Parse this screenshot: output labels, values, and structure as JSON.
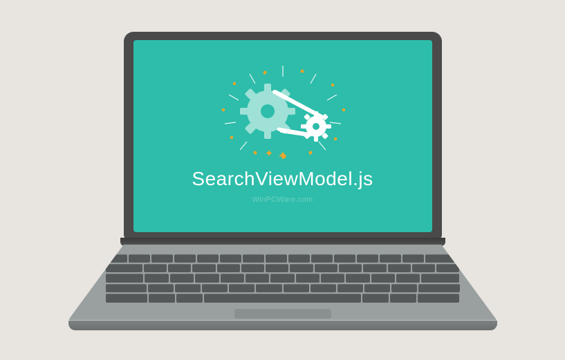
{
  "screen": {
    "filename": "SearchViewModel.js",
    "watermark": "WinPCWare.com"
  },
  "colors": {
    "screen_bg": "#2dbdaa",
    "accent": "#f5a623",
    "gear_light": "#9fe1d7",
    "gear_white": "#ffffff"
  }
}
